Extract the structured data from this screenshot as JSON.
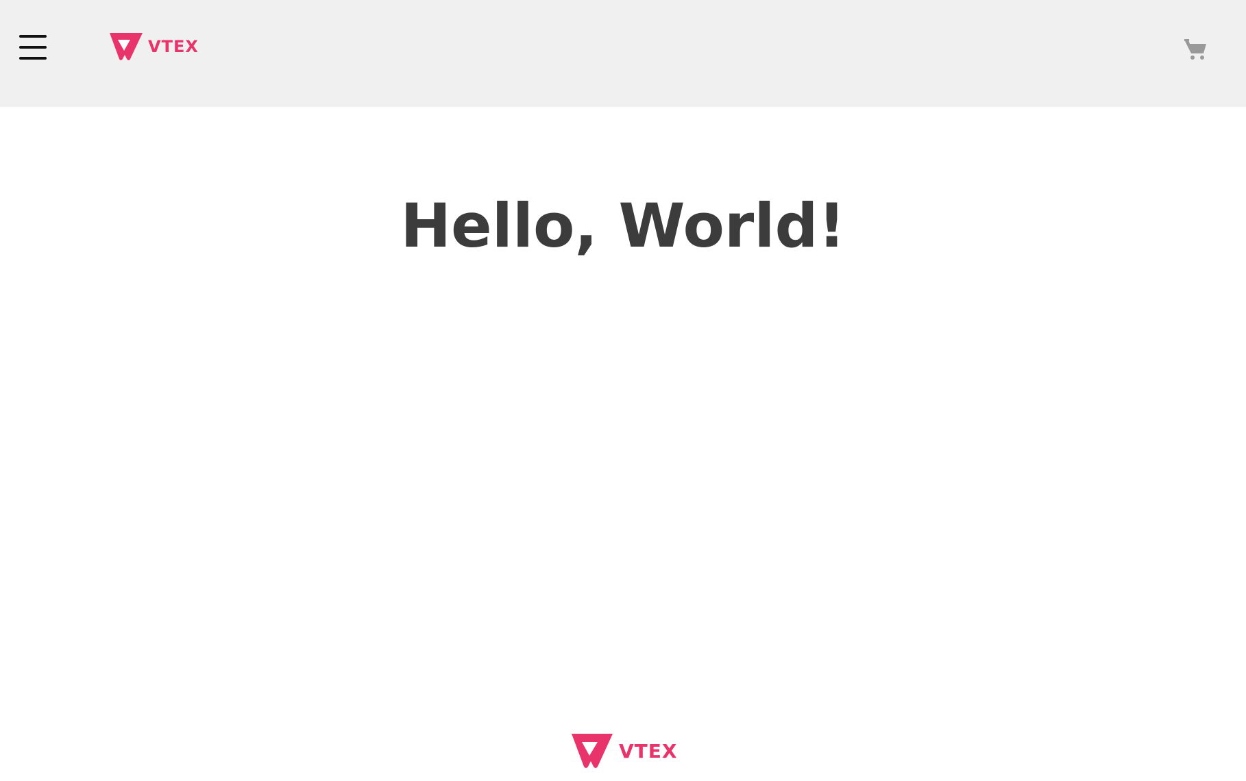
{
  "header": {
    "brand": "VTEX",
    "menu_icon": "hamburger-menu-icon",
    "cart_icon": "shopping-cart-icon"
  },
  "main": {
    "heading": "Hello, World!"
  },
  "footer": {
    "brand": "VTEX"
  },
  "colors": {
    "brand": "#e8336b",
    "header_bg": "#f0f0f0",
    "heading_text": "#3c3c3c",
    "cart_icon": "#999999"
  }
}
